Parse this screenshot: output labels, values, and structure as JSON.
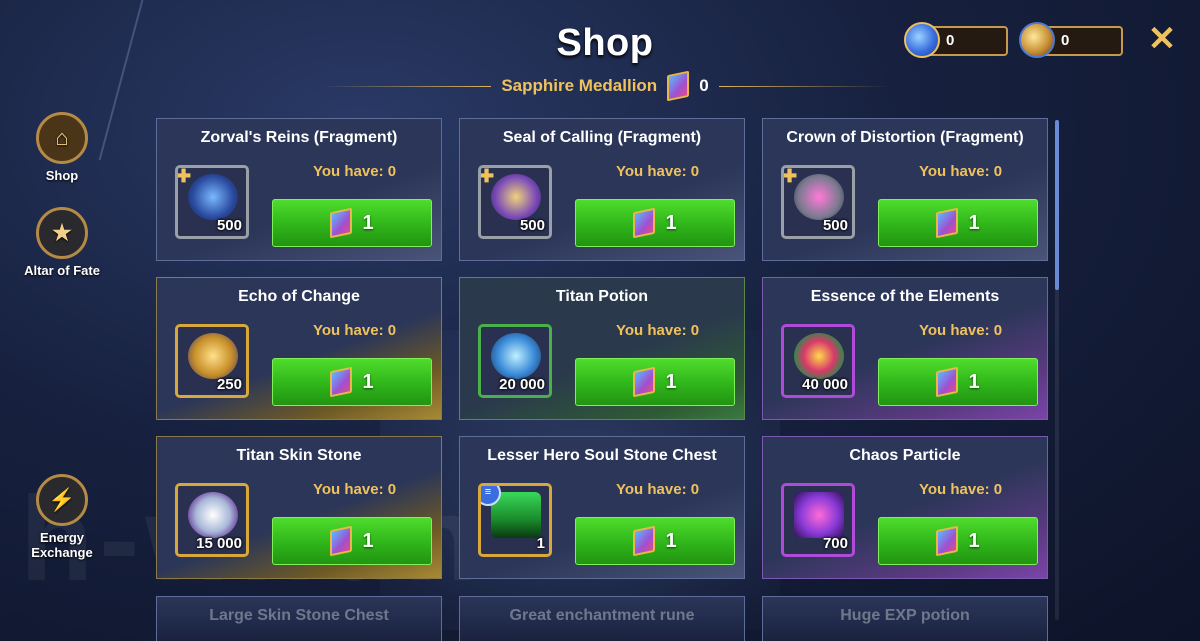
{
  "header": {
    "title": "Shop",
    "currency_name": "Sapphire Medallion",
    "currency_count": "0"
  },
  "resources": [
    {
      "icon": "blue-gem-icon",
      "value": "0"
    },
    {
      "icon": "gold-emblem-icon",
      "value": "0"
    }
  ],
  "close_label": "✕",
  "sidebar": {
    "shop": "Shop",
    "altar": "Altar of Fate",
    "energy_line1": "Energy",
    "energy_line2": "Exchange"
  },
  "items": [
    {
      "name": "Zorval's Reins (Fragment)",
      "owned": "You have: 0",
      "qty": "500",
      "price": "1",
      "rarity": "gray"
    },
    {
      "name": "Seal of Calling (Fragment)",
      "owned": "You have: 0",
      "qty": "500",
      "price": "1",
      "rarity": "gray"
    },
    {
      "name": "Crown of Distortion (Fragment)",
      "owned": "You have: 0",
      "qty": "500",
      "price": "1",
      "rarity": "gray"
    },
    {
      "name": "Echo of Change",
      "owned": "You have: 0",
      "qty": "250",
      "price": "1",
      "rarity": "gold"
    },
    {
      "name": "Titan Potion",
      "owned": "You have: 0",
      "qty": "20 000",
      "price": "1",
      "rarity": "green"
    },
    {
      "name": "Essence of the Elements",
      "owned": "You have: 0",
      "qty": "40 000",
      "price": "1",
      "rarity": "purple"
    },
    {
      "name": "Titan Skin Stone",
      "owned": "You have: 0",
      "qty": "15 000",
      "price": "1",
      "rarity": "gold"
    },
    {
      "name": "Lesser Hero Soul Stone Chest",
      "owned": "You have: 0",
      "qty": "1",
      "price": "1",
      "rarity": "gold"
    },
    {
      "name": "Chaos Particle",
      "owned": "You have: 0",
      "qty": "700",
      "price": "1",
      "rarity": "purple"
    }
  ],
  "partial_items": [
    "Large Skin Stone Chest",
    "Great enchantment rune",
    "Huge EXP potion"
  ],
  "watermark": "h-w.fun",
  "colors": {
    "button_green": "#2fb51a",
    "gold": "#f0c25e",
    "card_bg": "#2b3658"
  }
}
